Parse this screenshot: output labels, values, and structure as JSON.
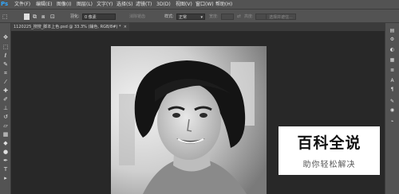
{
  "menubar": {
    "logo": "Ps",
    "items": [
      "文件(F)",
      "编辑(E)",
      "图像(I)",
      "图层(L)",
      "文字(Y)",
      "选择(S)",
      "滤镜(T)",
      "3D(D)",
      "视图(V)",
      "窗口(W)",
      "帮助(H)"
    ]
  },
  "options": {
    "feather_label": "羽化:",
    "feather_value": "0 像素",
    "antialias_label": "消除锯齿",
    "style_label": "样式:",
    "style_value": "正常",
    "width_label": "宽度:",
    "height_label": "高度:",
    "select_mask_button": "选择并遮住..."
  },
  "tab": {
    "title": "1120225_搜搜_脚本上色.psd @ 33.3% (辅色, RGB/8#) *",
    "close": "×"
  },
  "watermark": {
    "title": "百科全说",
    "subtitle": "助你轻松解决"
  },
  "tool_icons": [
    "move-icon",
    "marquee-icon",
    "lasso-icon",
    "quick-select-icon",
    "crop-icon",
    "eyedropper-icon",
    "healing-icon",
    "brush-icon",
    "stamp-icon",
    "history-brush-icon",
    "eraser-icon",
    "gradient-icon",
    "blur-icon",
    "dodge-icon",
    "pen-icon",
    "type-icon",
    "path-select-icon"
  ]
}
